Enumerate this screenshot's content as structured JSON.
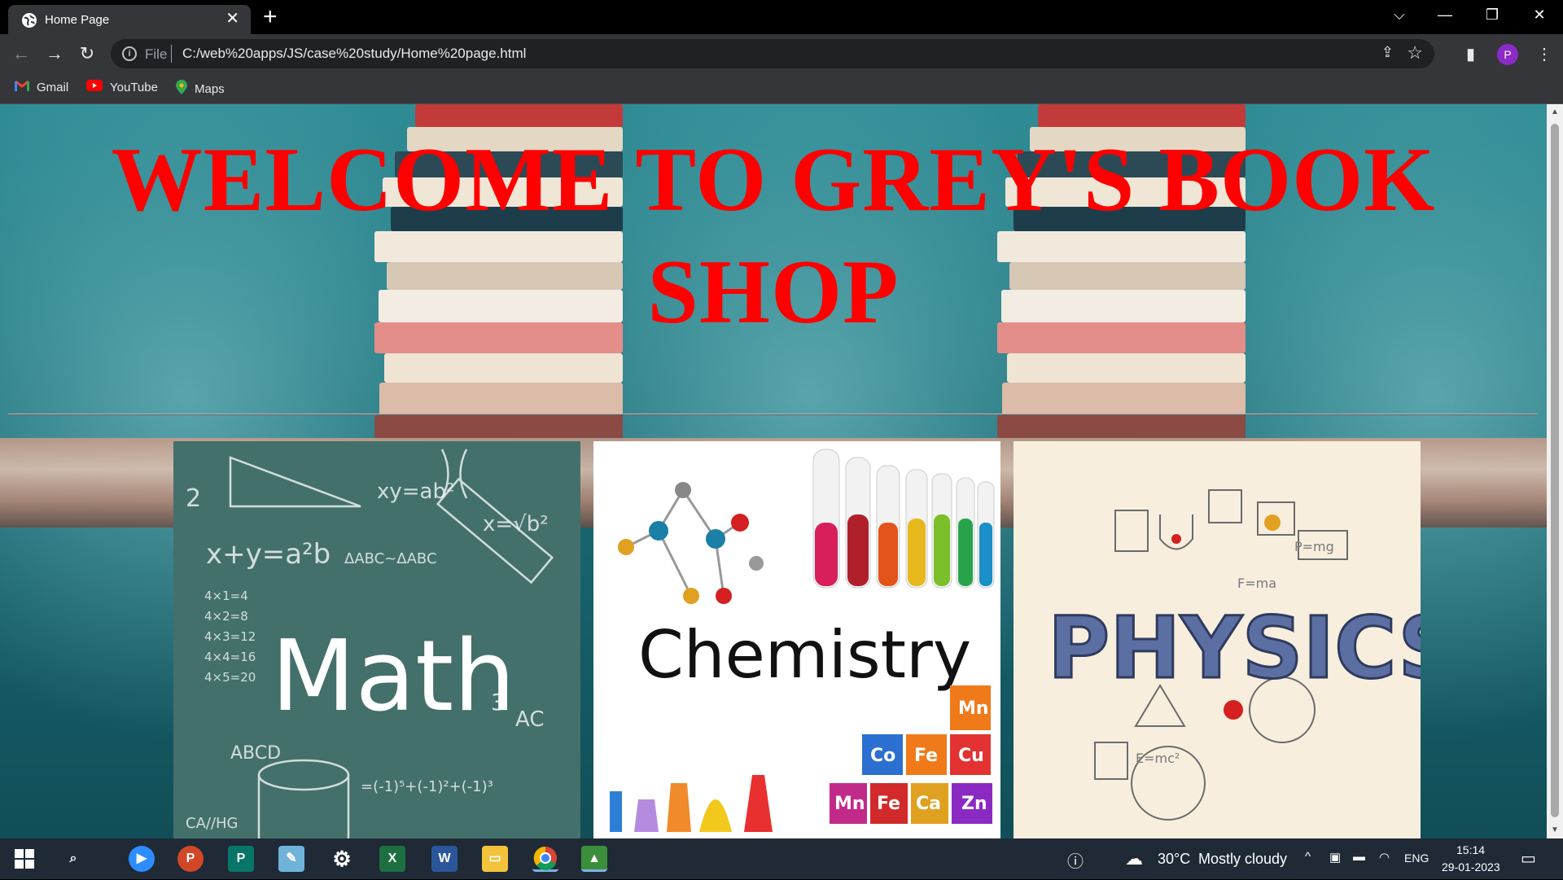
{
  "browser": {
    "tab_title": "Home Page",
    "tab_close": "✕",
    "new_tab": "+",
    "url_scheme": "File",
    "url": "C:/web%20apps/JS/case%20study/Home%20page.html",
    "profile_initial": "P",
    "window_controls": {
      "dropdown": "⌵",
      "minimize": "—",
      "restore": "❐",
      "close": "✕"
    }
  },
  "bookmarks": [
    {
      "label": "Gmail",
      "icon": "gmail-icon",
      "color": "#ea4335"
    },
    {
      "label": "YouTube",
      "icon": "youtube-icon",
      "color": "#ff0000"
    },
    {
      "label": "Maps",
      "icon": "maps-icon",
      "color": "#34a853"
    }
  ],
  "page": {
    "heading": "WELCOME TO GREY'S BOOK SHOP",
    "heading_color": "#ff0000",
    "subjects": [
      {
        "name": "Math",
        "image_text": "Math"
      },
      {
        "name": "Chemistry",
        "image_text": "Chemistry"
      },
      {
        "name": "Physics",
        "image_text": "PHYSICS"
      }
    ]
  },
  "taskbar": {
    "apps": [
      "start-icon",
      "search-icon",
      "zoom-icon",
      "powerpoint-icon",
      "publisher-icon",
      "notepad-icon",
      "settings-icon",
      "excel-icon",
      "word-icon",
      "file-explorer-icon",
      "chrome-icon",
      "image-app-icon"
    ],
    "weather_temp": "30°C",
    "weather_text": "Mostly cloudy",
    "language": "ENG",
    "time": "15:14",
    "date": "29-01-2023"
  }
}
